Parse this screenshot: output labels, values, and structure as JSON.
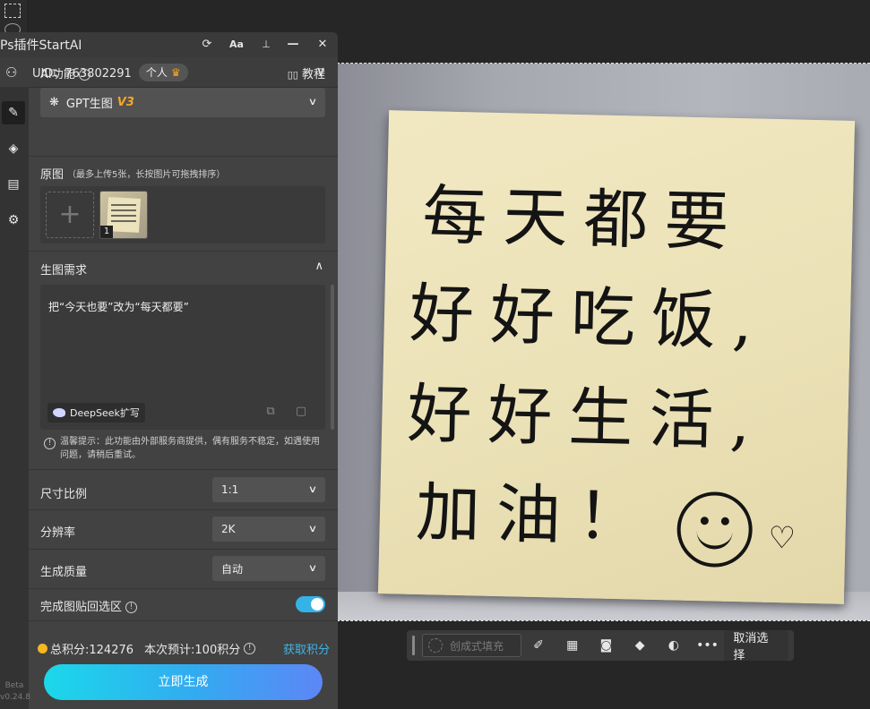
{
  "plugin": {
    "title": "Ps插件StartAI",
    "uid_label": "UID：763802291",
    "account_type": "个人",
    "ai_function_label": "AI功能",
    "tutorial_label": "教程",
    "selected_model": "GPT生图",
    "model_version": "V3",
    "source_image_label": "原图",
    "source_image_hint": "（最多上传5张，长按图片可拖拽排序）",
    "thumbnail_index": "1",
    "prompt_section_label": "生图需求",
    "prompt_text": "把“今天也要”改为“每天都要”",
    "deepseek_label": "DeepSeek扩写",
    "tip_text": "温馨提示：此功能由外部服务商提供，偶有服务不稳定，如遇使用问题，请稍后重试。",
    "aspect_ratio_label": "尺寸比例",
    "aspect_ratio_value": "1:1",
    "resolution_label": "分辨率",
    "resolution_value": "2K",
    "quality_label": "生成质量",
    "quality_value": "自动",
    "paste_back_label": "完成图贴回选区",
    "paste_back_enabled": true,
    "total_points": "总积分:124276",
    "estimated_cost": "本次预计:100积分",
    "get_points_label": "获取积分",
    "generate_button": "立即生成",
    "beta_label": "Beta",
    "version": "v0.24.8"
  },
  "canvas": {
    "note_lines": [
      "每天都要",
      "好好吃饭,",
      "好好生活,",
      "加油！"
    ],
    "heart": "♡"
  },
  "taskbar": {
    "generative_fill_placeholder": "创成式填充",
    "deselect_label": "取消选择"
  },
  "icons": {
    "refresh": "⟳",
    "font": "Aa",
    "pin": "📌",
    "minimize": "—",
    "close": "✕",
    "users": "👥",
    "crown": "♛",
    "chevron_down": "⌄",
    "chevron_up": "⌃",
    "book": "📖",
    "model": "❋",
    "brush": "✎",
    "layers": "◈",
    "document": "▤",
    "gear": "⚙",
    "trash": "🗑",
    "copy": "⧉",
    "more": "•••"
  },
  "colors": {
    "panel_bg": "#424242",
    "accent_cyan": "#35b3e6",
    "gen_button_gradient_start": "#1bd8ea",
    "gen_button_gradient_end": "#5d86f7",
    "version_badge": "#f5a623",
    "get_points_link": "#3fb4e8"
  }
}
